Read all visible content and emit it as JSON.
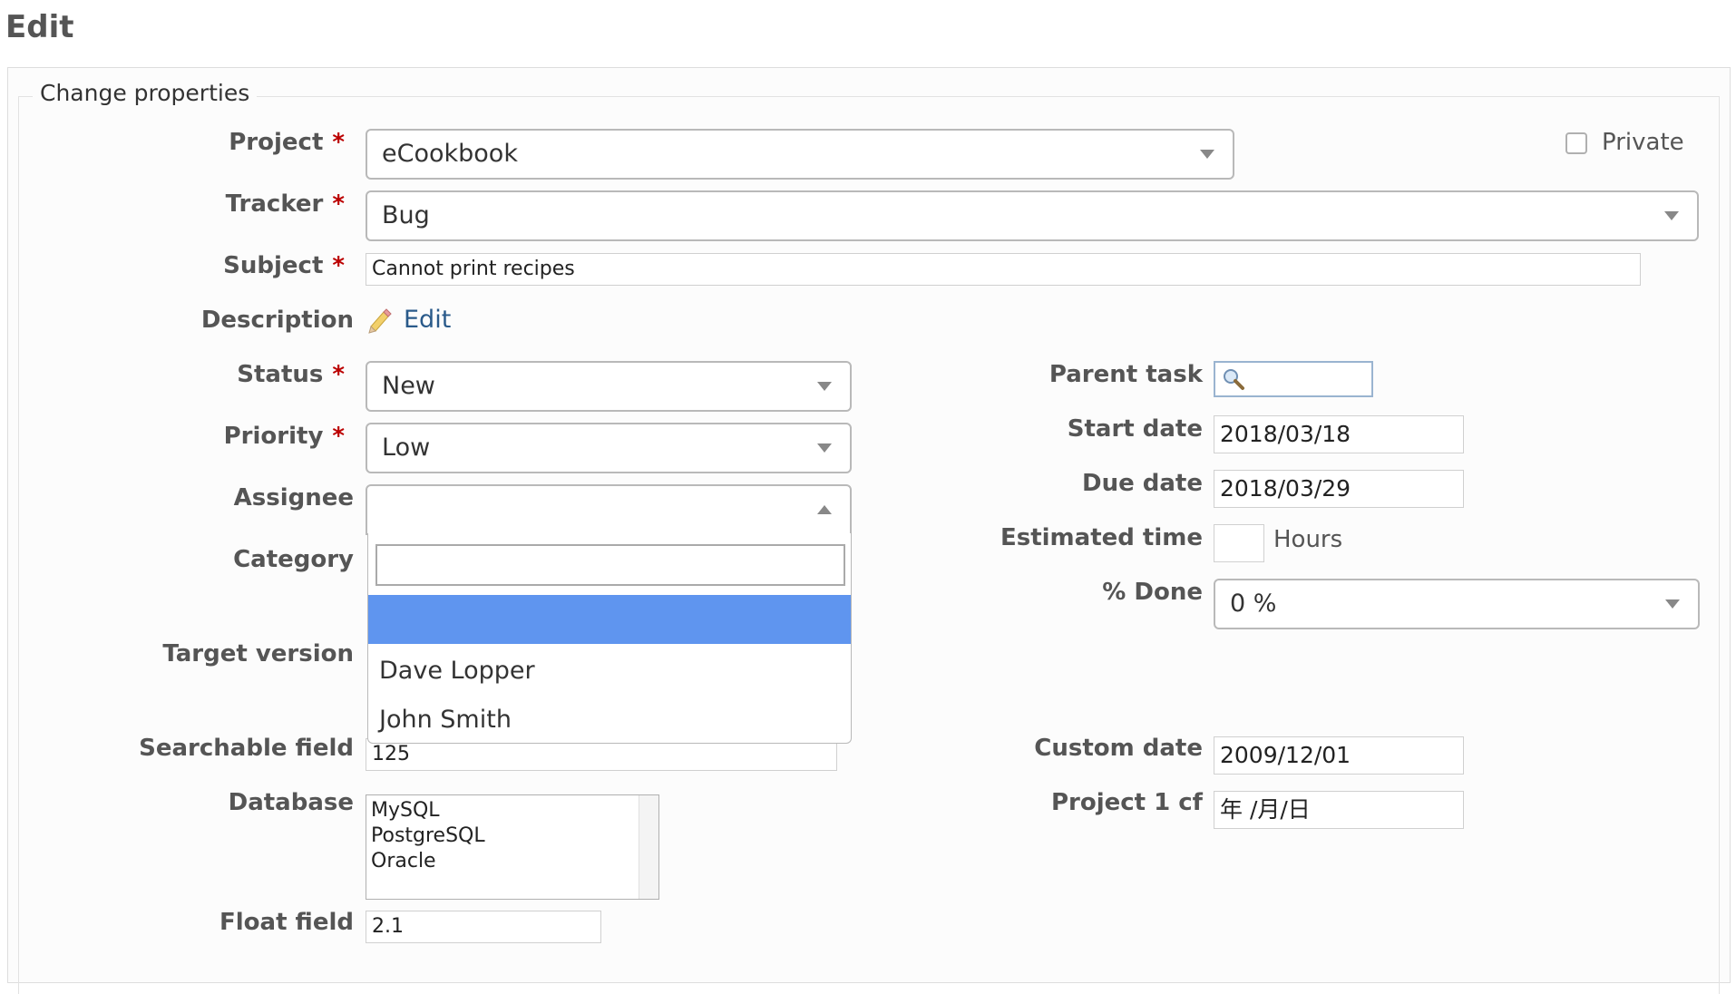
{
  "page": {
    "title": "Edit"
  },
  "form": {
    "legend": "Change properties",
    "project": {
      "label": "Project",
      "value": "eCookbook"
    },
    "private": {
      "label": "Private",
      "checked": false
    },
    "tracker": {
      "label": "Tracker",
      "value": "Bug"
    },
    "subject": {
      "label": "Subject",
      "value": "Cannot print recipes"
    },
    "description": {
      "label": "Description",
      "edit_link": "Edit"
    },
    "status": {
      "label": "Status",
      "value": "New"
    },
    "priority": {
      "label": "Priority",
      "value": "Low"
    },
    "assignee": {
      "label": "Assignee",
      "value": "",
      "search_value": "",
      "options": [
        "",
        "Dave Lopper",
        "John Smith"
      ],
      "highlighted_index": 0
    },
    "category": {
      "label": "Category"
    },
    "target_version": {
      "label": "Target version"
    },
    "searchable_field": {
      "label": "Searchable field",
      "value": "125"
    },
    "database": {
      "label": "Database",
      "options": [
        "MySQL",
        "PostgreSQL",
        "Oracle"
      ]
    },
    "float_field": {
      "label": "Float field",
      "value": "2.1"
    },
    "parent_task": {
      "label": "Parent task",
      "value": ""
    },
    "start_date": {
      "label": "Start date",
      "value": "2018/03/18"
    },
    "due_date": {
      "label": "Due date",
      "value": "2018/03/29"
    },
    "estimated_time": {
      "label": "Estimated time",
      "value": "",
      "unit": "Hours"
    },
    "done_ratio": {
      "label": "% Done",
      "value": "0 %"
    },
    "custom_date": {
      "label": "Custom date",
      "value": "2009/12/01"
    },
    "project_1_cf": {
      "label": "Project 1 cf",
      "value": "年 /月/日"
    },
    "required_marker": "*"
  },
  "colors": {
    "required": "#bb0000",
    "highlight": "#5f95ef",
    "link": "#2a5a8a"
  },
  "icons": {
    "description_edit": "pencil-icon",
    "parent_task_search": "magnifier-icon",
    "select_caret": "chevron-down-icon"
  }
}
